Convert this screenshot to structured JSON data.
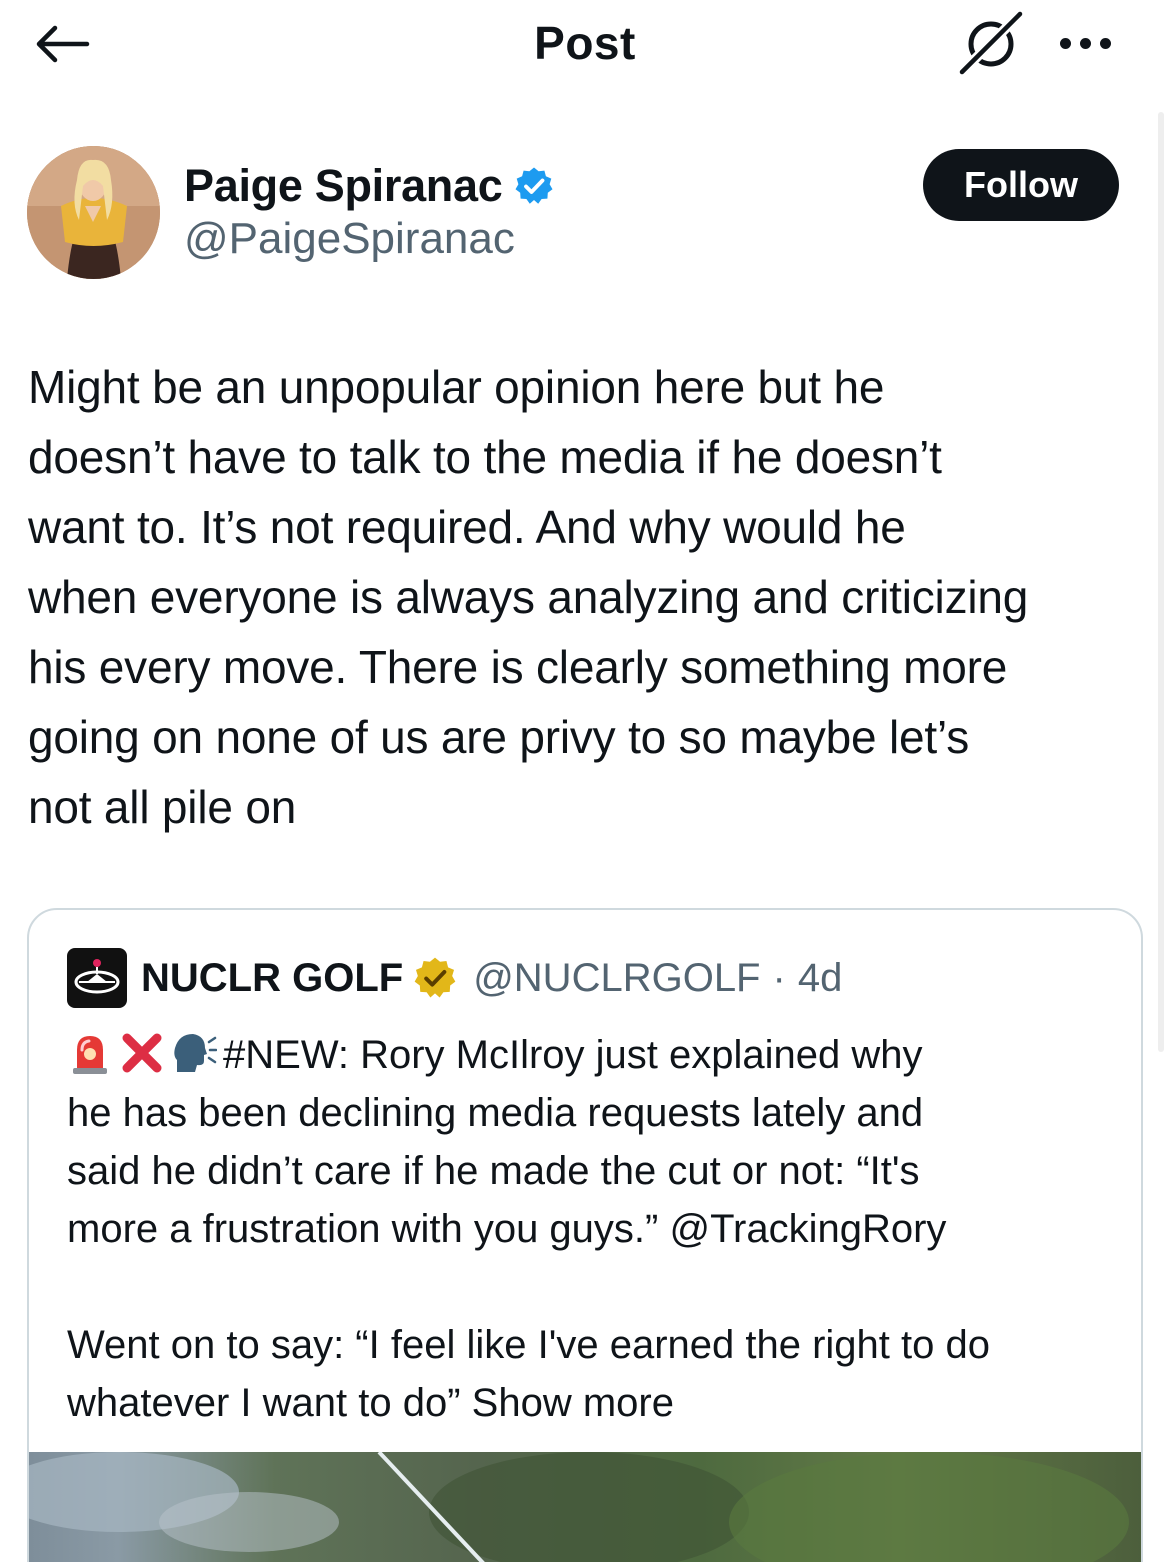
{
  "header": {
    "title": "Post",
    "back_icon": "arrow-left-icon",
    "grok_icon": "grok-icon",
    "more_icon": "ellipsis-icon"
  },
  "author": {
    "name": "Paige Spiranac",
    "handle": "@PaigeSpiranac",
    "verified": true,
    "verified_color": "#1d9bf0",
    "follow_label": "Follow"
  },
  "post": {
    "lines": [
      "Might be an unpopular opinion here but he",
      "doesn’t have to talk to the media if he doesn’t",
      "want to. It’s not required. And why would he",
      "when everyone is always analyzing and criticizing",
      "his every move. There is clearly something more",
      "going on none of us are privy to so maybe let’s",
      "not all pile on"
    ]
  },
  "quote": {
    "name": "NUCLR GOLF",
    "handle": "@NUCLRGOLF",
    "separator": "·",
    "time": "4d",
    "badge_color": "#e2b719",
    "emojis": [
      "police-light-icon",
      "cross-mark-icon",
      "speaking-head-icon"
    ],
    "lines": [
      "#NEW: Rory McIlroy just explained why",
      "he has been declining media requests lately and",
      "said he didn’t care if he made the cut or not:  “It's",
      "more a frustration with you guys.” @TrackingRory",
      "Went on to say: “I feel like I've earned the right to do",
      "whatever I want to do”"
    ],
    "show_more": "Show more"
  }
}
